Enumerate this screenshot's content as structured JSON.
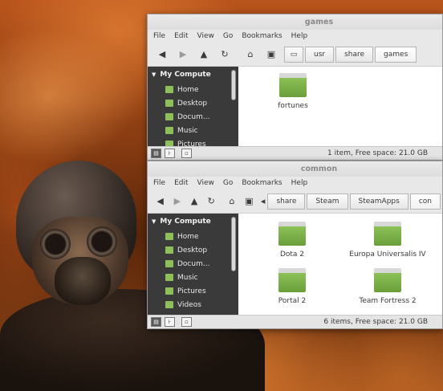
{
  "windows": {
    "games": {
      "title": "games",
      "menu": [
        "File",
        "Edit",
        "View",
        "Go",
        "Bookmarks",
        "Help"
      ],
      "breadcrumbs": [
        "usr",
        "share",
        "games"
      ],
      "sidebar": {
        "heading": "My Compute",
        "items": [
          {
            "label": "Home",
            "icon": "home-folder-icon"
          },
          {
            "label": "Desktop",
            "icon": "desktop-folder-icon"
          },
          {
            "label": "Docum...",
            "icon": "documents-folder-icon"
          },
          {
            "label": "Music",
            "icon": "music-folder-icon"
          },
          {
            "label": "Pictures",
            "icon": "pictures-folder-icon"
          }
        ]
      },
      "items": [
        "fortunes"
      ],
      "status": "1 item, Free space: 21.0 GB"
    },
    "common": {
      "title": "common",
      "menu": [
        "File",
        "Edit",
        "View",
        "Go",
        "Bookmarks",
        "Help"
      ],
      "breadcrumbs": [
        "share",
        "Steam",
        "SteamApps",
        "con"
      ],
      "sidebar": {
        "heading": "My Compute",
        "items": [
          {
            "label": "Home",
            "icon": "home-folder-icon"
          },
          {
            "label": "Desktop",
            "icon": "desktop-folder-icon"
          },
          {
            "label": "Docum...",
            "icon": "documents-folder-icon"
          },
          {
            "label": "Music",
            "icon": "music-folder-icon"
          },
          {
            "label": "Pictures",
            "icon": "pictures-folder-icon"
          },
          {
            "label": "Videos",
            "icon": "videos-folder-icon"
          }
        ]
      },
      "items": [
        "Dota 2",
        "Europa Universalis IV",
        "Portal 2",
        "Team Fortress 2"
      ],
      "status": "6 items, Free space: 21.0 GB"
    }
  },
  "colors": {
    "folder_green": "#7db347",
    "sidebar_bg": "#3a3a3a"
  }
}
